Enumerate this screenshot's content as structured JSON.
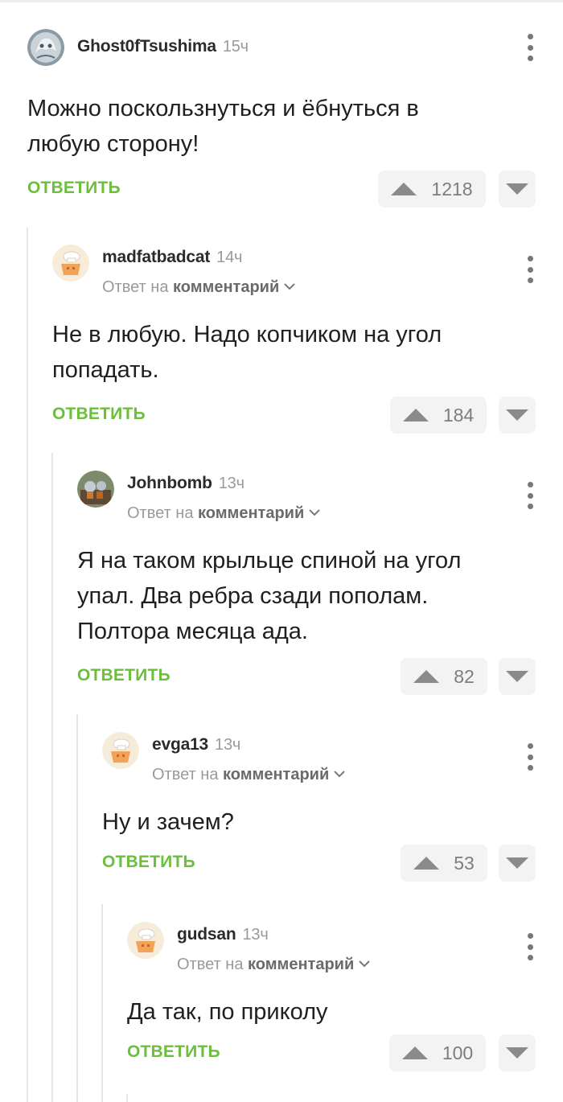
{
  "reply_label": "ОТВЕТИТЬ",
  "reply_to_prefix": "Ответ на",
  "reply_to_target": "комментарий",
  "accent_color": "#6bbf3b",
  "comments": [
    {
      "author": "Ghost0fTsushima",
      "time": "15ч",
      "text": "Можно поскользнуться и ёбнуться в любую сторону!",
      "votes": "1218",
      "avatar_icon": "ghost-avatar"
    },
    {
      "author": "madfatbadcat",
      "time": "14ч",
      "text": "Не в любую. Надо копчиком на угол попадать.",
      "votes": "184",
      "avatar_icon": "cupcake-avatar"
    },
    {
      "author": "Johnbomb",
      "time": "13ч",
      "text": "Я на таком крыльце спиной на угол упал. Два ребра сзади пополам. Полтора месяца ада.",
      "votes": "82",
      "avatar_icon": "photo-avatar"
    },
    {
      "author": "evga13",
      "time": "13ч",
      "text": "Ну и зачем?",
      "votes": "53",
      "avatar_icon": "cupcake-avatar"
    },
    {
      "author": "gudsan",
      "time": "13ч",
      "text": "Да так, по приколу",
      "votes": "100",
      "avatar_icon": "cupcake-avatar"
    }
  ]
}
